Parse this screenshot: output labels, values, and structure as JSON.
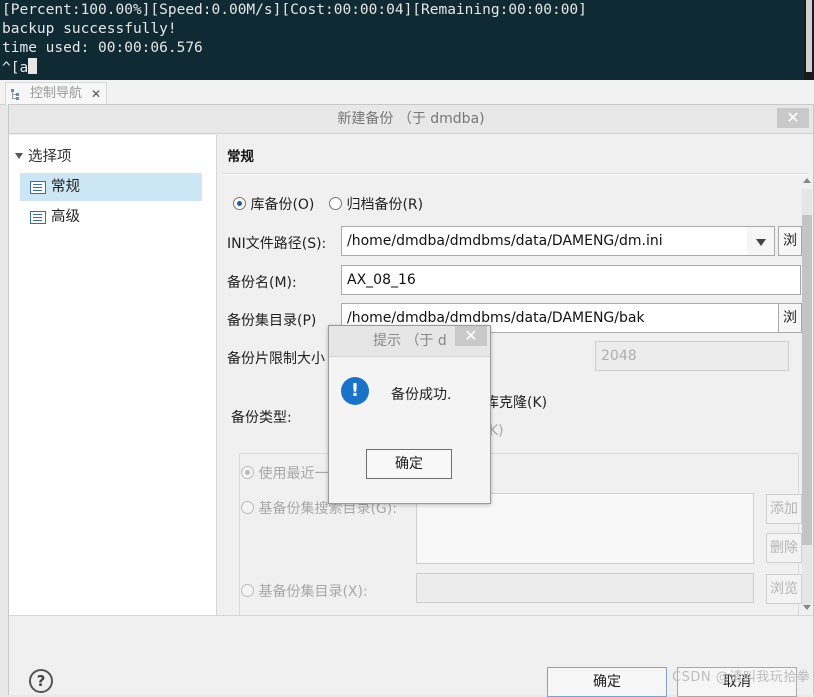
{
  "terminal": {
    "lines": [
      "[Percent:100.00%][Speed:0.00M/s][Cost:00:00:04][Remaining:00:00:00]",
      "backup successfully!",
      "time used: 00:00:06.576",
      "^[a"
    ]
  },
  "tabs": {
    "nav_label": "控制导航",
    "close_glyph": "✕"
  },
  "dialog": {
    "title": "新建备份 （于 dmdba)",
    "close_glyph": "✕",
    "tree": {
      "header": "选择项",
      "items": [
        {
          "label": "常规"
        },
        {
          "label": "高级"
        }
      ]
    },
    "section_title": "常规",
    "backup_mode": {
      "db_label": "库备份(O)",
      "archive_label": "归档备份(R)"
    },
    "ini_path": {
      "label": "INI文件路径(S):",
      "value": "/home/dmdba/dmdbms/data/DAMENG/dm.ini",
      "browse": "浏"
    },
    "backup_name": {
      "label": "备份名(M):",
      "value": "AX_08_16"
    },
    "backup_dir": {
      "label": "备份集目录(P)",
      "value": "/home/dmdba/dmdbms/data/DAMENG/bak",
      "browse": "浏"
    },
    "piece_limit": {
      "label": "备份片限制大小",
      "value": "2048"
    },
    "backup_type": {
      "label": "备份类型:",
      "clone_label": "库克隆(K)",
      "partial_suffix": "K)"
    },
    "base": {
      "use_latest": "使用最近一",
      "search_dir_label": "基备份集搜索目录(G):",
      "add_btn": "添加",
      "delete_btn": "删除",
      "base_dir_label": "基备份集目录(X):",
      "browse_btn": "浏览"
    },
    "footer": {
      "help": "?",
      "ok": "确定",
      "cancel": "取消"
    }
  },
  "popup": {
    "title": "提示  （于 d",
    "close_glyph": "✕",
    "icon": "!",
    "message": "备份成功.",
    "ok": "确定"
  },
  "watermark": "CSDN @请叫我玩拾拳"
}
